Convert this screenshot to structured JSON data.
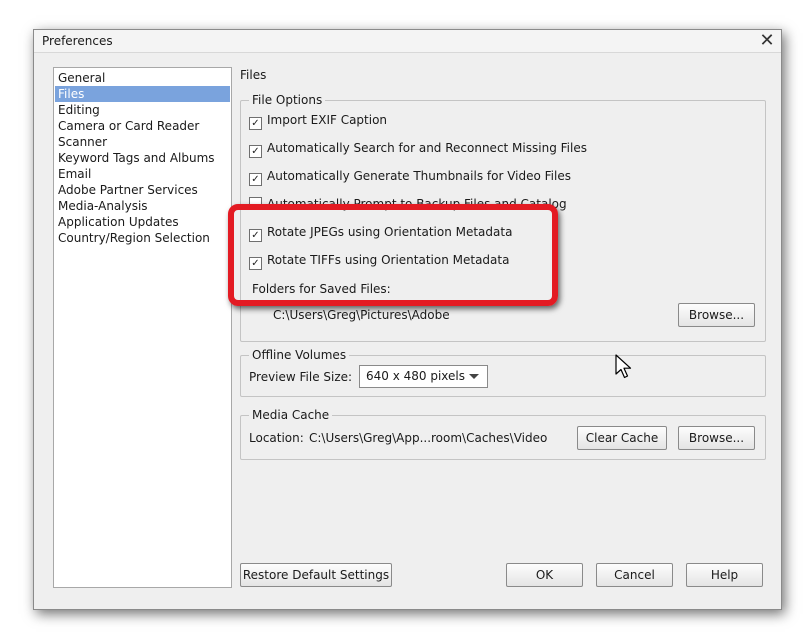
{
  "window": {
    "title": "Preferences"
  },
  "sidebar": {
    "items": [
      {
        "label": "General",
        "selected": false
      },
      {
        "label": "Files",
        "selected": true
      },
      {
        "label": "Editing",
        "selected": false
      },
      {
        "label": "Camera or Card Reader",
        "selected": false
      },
      {
        "label": "Scanner",
        "selected": false
      },
      {
        "label": "Keyword Tags and Albums",
        "selected": false
      },
      {
        "label": "Email",
        "selected": false
      },
      {
        "label": "Adobe Partner Services",
        "selected": false
      },
      {
        "label": "Media-Analysis",
        "selected": false
      },
      {
        "label": "Application Updates",
        "selected": false
      },
      {
        "label": "Country/Region Selection",
        "selected": false
      }
    ]
  },
  "panel": {
    "title": "Files"
  },
  "file_options": {
    "legend": "File Options",
    "checkboxes": [
      {
        "label": "Import EXIF Caption",
        "checked": true
      },
      {
        "label": "Automatically Search for and Reconnect Missing Files",
        "checked": true
      },
      {
        "label": "Automatically Generate Thumbnails for Video Files",
        "checked": true
      },
      {
        "label": "Automatically Prompt to Backup Files and Catalog",
        "checked": false
      },
      {
        "label": "Rotate JPEGs using Orientation Metadata",
        "checked": true
      },
      {
        "label": "Rotate TIFFs using Orientation Metadata",
        "checked": true
      }
    ],
    "saved_files_legend": "Folders for Saved Files:",
    "saved_files_path": "C:\\Users\\Greg\\Pictures\\Adobe",
    "browse_label": "Browse..."
  },
  "offline_volumes": {
    "legend": "Offline Volumes",
    "preview_label": "Preview File Size:",
    "preview_value": "640 x 480 pixels"
  },
  "media_cache": {
    "legend": "Media Cache",
    "location_label": "Location:",
    "location_value": "C:\\Users\\Greg\\App...room\\Caches\\Video",
    "clear_label": "Clear Cache",
    "browse_label": "Browse..."
  },
  "footer": {
    "restore_label": "Restore Default Settings",
    "ok_label": "OK",
    "cancel_label": "Cancel",
    "help_label": "Help"
  },
  "icons": {
    "close": "close-icon",
    "cursor": "mouse-pointer-icon",
    "check": "checkmark-icon",
    "dropdown": "chevron-down-icon"
  },
  "colors": {
    "selection": "#7aa3dd",
    "highlight": "#e31b23"
  }
}
